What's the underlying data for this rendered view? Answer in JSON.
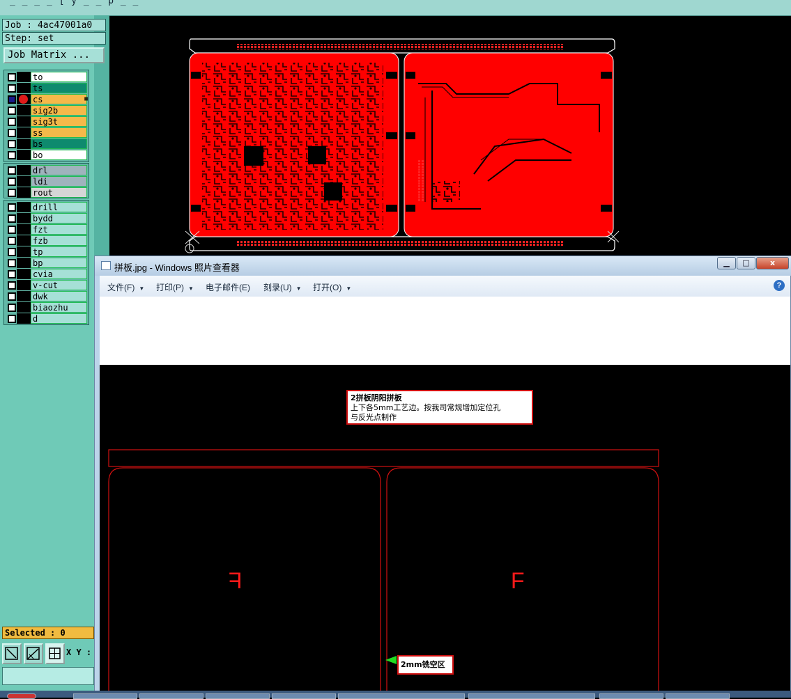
{
  "app": {
    "title_fragment": "_  _ _  _  [  y  _  _ p _   _",
    "job_label": "Job : 4ac47001a0",
    "step_label": "Step: set",
    "job_matrix_button": "Job Matrix ...",
    "selected_label": "Selected : 0",
    "xy_label": "X Y :"
  },
  "layers_board": [
    {
      "name": "to",
      "color": "#ffffff",
      "checked": false,
      "active": false
    },
    {
      "name": "ts",
      "color": "#0e8a6e",
      "checked": false,
      "active": false
    },
    {
      "name": "cs",
      "color": "#f5b94a",
      "checked": true,
      "active": true
    },
    {
      "name": "sig2b",
      "color": "#f5b94a",
      "checked": false,
      "active": false
    },
    {
      "name": "sig3t",
      "color": "#f5b94a",
      "checked": false,
      "active": false
    },
    {
      "name": "ss",
      "color": "#f5b94a",
      "checked": false,
      "active": false
    },
    {
      "name": "bs",
      "color": "#0e8a6e",
      "checked": false,
      "active": false
    },
    {
      "name": "bo",
      "color": "#ffffff",
      "checked": false,
      "active": false
    }
  ],
  "layers_drill": [
    {
      "name": "drl",
      "color": "#9fb3bd"
    },
    {
      "name": "ldi",
      "color": "#9fb3bd"
    },
    {
      "name": "rout",
      "color": "#d6d6d6"
    }
  ],
  "layers_misc": [
    {
      "name": "drill"
    },
    {
      "name": "bydd"
    },
    {
      "name": "fzt"
    },
    {
      "name": "fzb"
    },
    {
      "name": "tp"
    },
    {
      "name": "bp"
    },
    {
      "name": "cvia"
    },
    {
      "name": "v-cut"
    },
    {
      "name": "dwk"
    },
    {
      "name": "biaozhu"
    },
    {
      "name": "d"
    }
  ],
  "viewer": {
    "title": "拼板.jpg - Windows 照片查看器",
    "menus": [
      "文件(F)",
      "打印(P)",
      "电子邮件(E)",
      "刻录(U)",
      "打开(O)"
    ],
    "help": "?",
    "buttons": {
      "minimize": "▁",
      "maximize": "□",
      "close": "x"
    }
  },
  "image": {
    "note_title": "2拼板阴阳拼板",
    "note_line1": "上下各5mm工艺边。按我司常规增加定位孔",
    "note_line2": "与反光点制作",
    "letter_left": "F",
    "letter_right": "F",
    "mill_note": "2mm铣空区"
  },
  "colors": {
    "copper": "#ff0000",
    "panel_bg": "#6fcab7",
    "accent_board": "#f5b94a",
    "outline": "#d01010"
  }
}
